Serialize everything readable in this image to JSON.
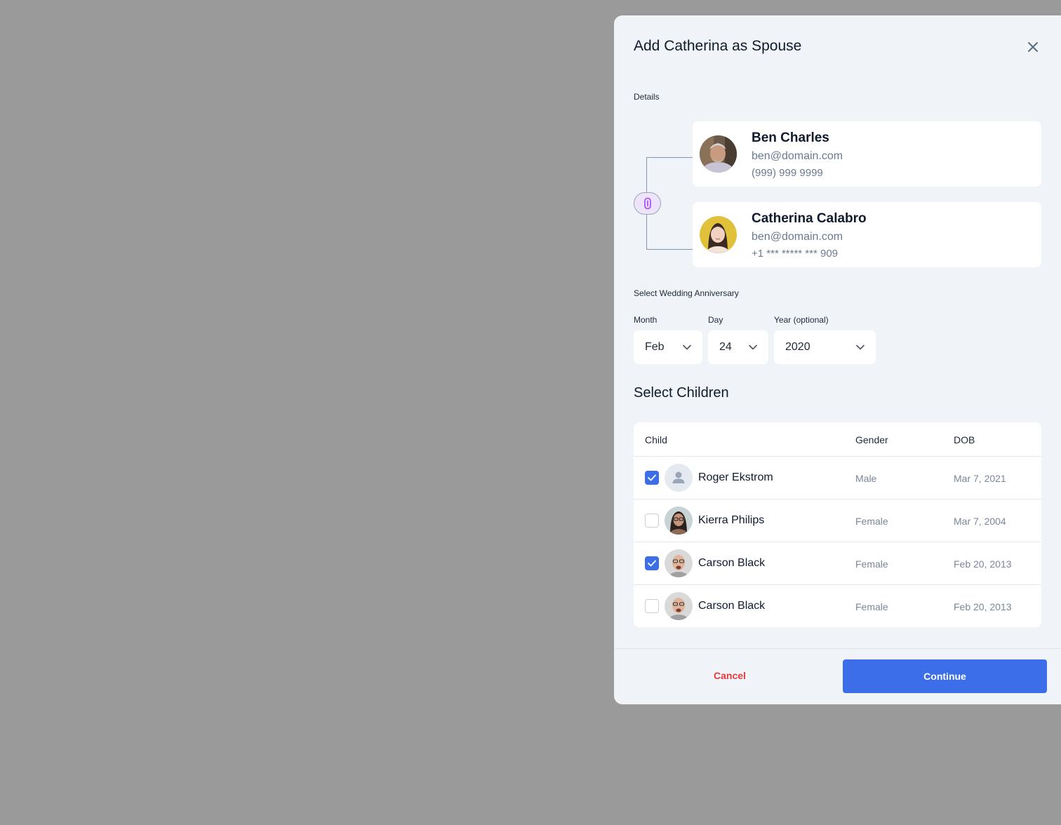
{
  "modal": {
    "title": "Add Catherina as Spouse",
    "details_label": "Details",
    "people": [
      {
        "name": "Ben Charles",
        "email": "ben@domain.com",
        "phone": "(999) 999 9999"
      },
      {
        "name": "Catherina Calabro",
        "email": "ben@domain.com",
        "phone": "+1 *** ***** *** 909"
      }
    ],
    "anniversary": {
      "label": "Select Wedding Anniversary",
      "month_label": "Month",
      "month_value": "Feb",
      "day_label": "Day",
      "day_value": "24",
      "year_label": "Year (optional)",
      "year_value": "2020"
    },
    "children": {
      "title": "Select Children",
      "columns": [
        "Child",
        "Gender",
        "DOB"
      ],
      "rows": [
        {
          "name": "Roger Ekstrom",
          "gender": "Male",
          "dob": "Mar 7, 2021",
          "checked": true
        },
        {
          "name": "Kierra Philips",
          "gender": "Female",
          "dob": "Mar 7, 2004",
          "checked": false
        },
        {
          "name": "Carson Black",
          "gender": "Female",
          "dob": "Feb 20, 2013",
          "checked": true
        },
        {
          "name": "Carson Black",
          "gender": "Female",
          "dob": "Feb 20, 2013",
          "checked": false
        }
      ]
    },
    "footer": {
      "cancel_label": "Cancel",
      "continue_label": "Continue"
    }
  },
  "colors": {
    "primary": "#3b6ee8",
    "danger": "#e5393b",
    "backdrop": "#9a9a9a",
    "panel": "#f0f3f8"
  },
  "icons": {
    "close": "close-icon",
    "link": "link-icon",
    "chevron": "chevron-down-icon",
    "check": "checkmark-icon",
    "placeholder_avatar": "user-placeholder-icon"
  }
}
